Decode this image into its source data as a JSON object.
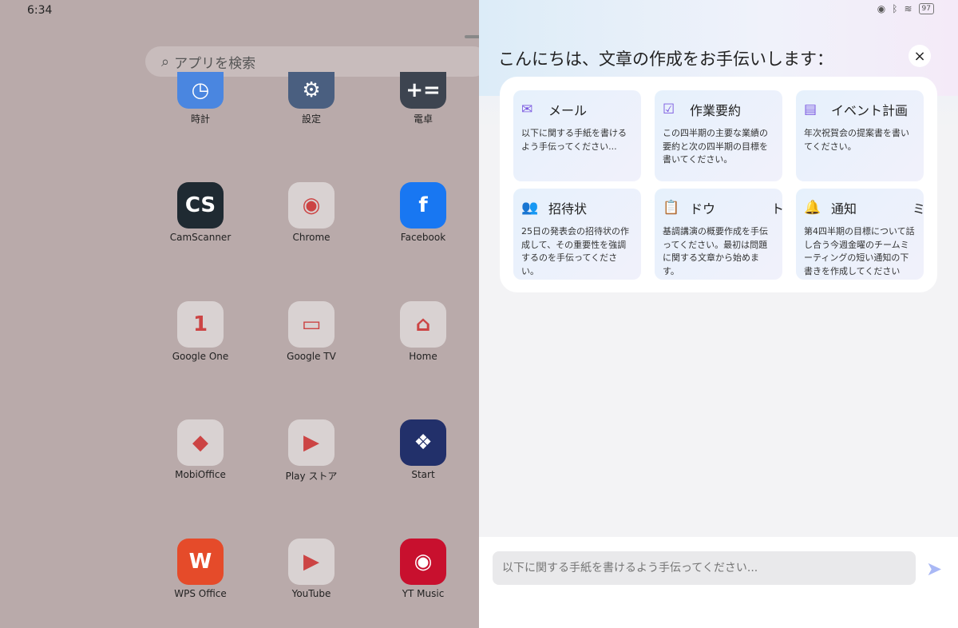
{
  "status": {
    "time": "6:34",
    "battery": "97"
  },
  "launcher": {
    "search_placeholder": "アプリを検索",
    "apps": [
      {
        "label": "時計",
        "glyph": "◷",
        "color": "#4a86e0"
      },
      {
        "label": "設定",
        "glyph": "⚙",
        "color": "#4a5f80"
      },
      {
        "label": "電卓",
        "glyph": "+=",
        "color": "#3d4450"
      },
      {
        "label": "CamScanner",
        "glyph": "CS",
        "color": "#1f2a32"
      },
      {
        "label": "Chrome",
        "glyph": "◉",
        "color": "#d9d2d2"
      },
      {
        "label": "Facebook",
        "glyph": "f",
        "color": "#1877f2"
      },
      {
        "label": "Google One",
        "glyph": "1",
        "color": "#d9d2d2"
      },
      {
        "label": "Google TV",
        "glyph": "▭",
        "color": "#d9d2d2"
      },
      {
        "label": "Home",
        "glyph": "⌂",
        "color": "#d9d2d2"
      },
      {
        "label": "MobiOffice",
        "glyph": "◆",
        "color": "#d9d2d2"
      },
      {
        "label": "Play ストア",
        "glyph": "▶",
        "color": "#d9d2d2"
      },
      {
        "label": "Start",
        "glyph": "❖",
        "color": "#22306a"
      },
      {
        "label": "WPS Office",
        "glyph": "W",
        "color": "#e54b2a"
      },
      {
        "label": "YouTube",
        "glyph": "▶",
        "color": "#d9d2d2"
      },
      {
        "label": "YT Music",
        "glyph": "◉",
        "color": "#c8102e"
      }
    ]
  },
  "assistant": {
    "title": "こんにちは、文章の作成をお手伝いします：",
    "close_icon": "×",
    "cards": [
      {
        "icon": "✉",
        "title": "メール",
        "text": "以下に関する手紙を書けるよう手伝ってください..."
      },
      {
        "icon": "☑",
        "title": "作業要約",
        "text": "この四半期の主要な業績の要約と次の四半期の目標を書いてください。"
      },
      {
        "icon": "▤",
        "title": "イベント計画",
        "text": "年次祝賀会の提案書を書いてください。"
      },
      {
        "icon": "👥",
        "title": "招待状",
        "text": "25日の発表会の招待状の作成して、その重要性を強調するのを手伝ってください。"
      },
      {
        "icon": "📋",
        "title": "ドウ",
        "fragment": "ト",
        "text": "基調講演の概要作成を手伝ってください。最初は問題に関する文章から始めます。"
      },
      {
        "icon": "🔔",
        "title": "通知",
        "fragment": "ミ",
        "text": "第4四半期の目標について話し合う今週金曜のチームミーティングの短い通知の下書きを作成してください"
      }
    ],
    "input_placeholder": "以下に関する手紙を書けるよう手伝ってください...",
    "send_icon": "➤"
  }
}
